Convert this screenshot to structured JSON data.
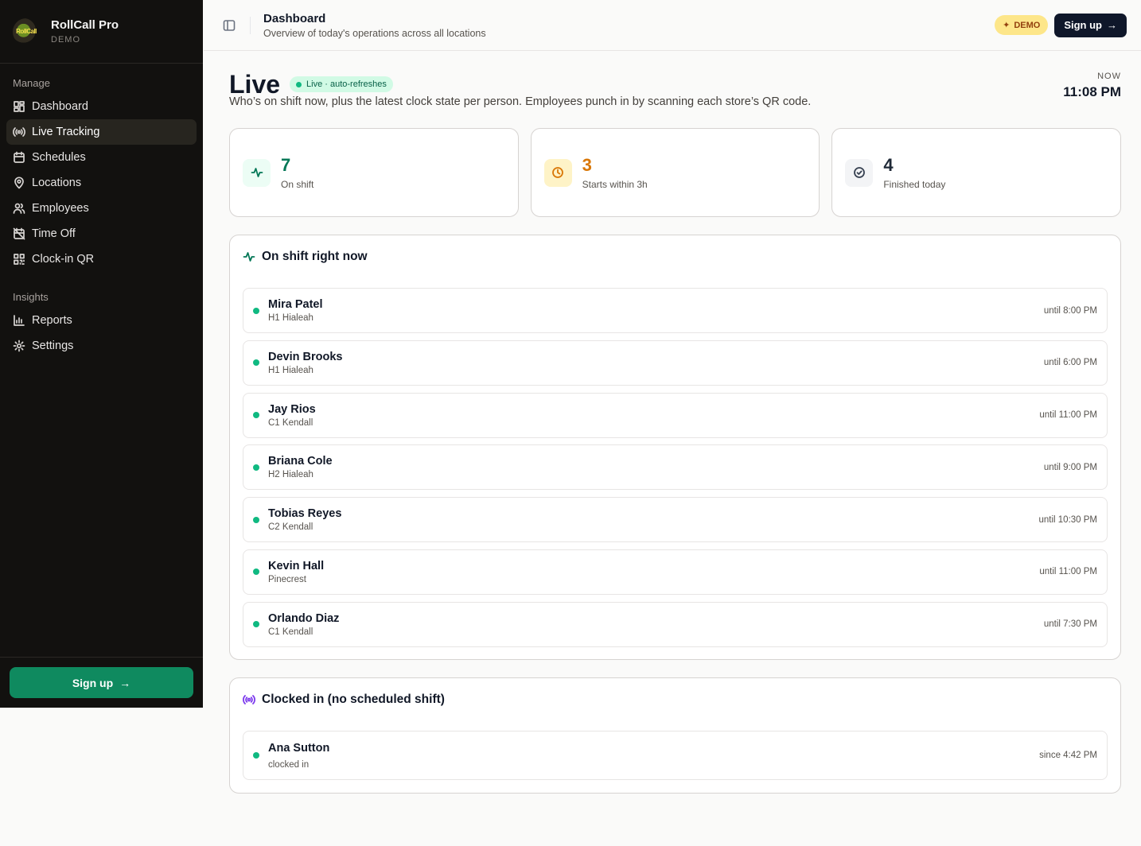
{
  "brand": {
    "name": "RollCall Pro",
    "sub": "DEMO",
    "logo_text": "RollCall"
  },
  "sidebar": {
    "sections": [
      {
        "label": "Manage",
        "items": [
          {
            "label": "Dashboard",
            "icon": "dashboard-icon"
          },
          {
            "label": "Live Tracking",
            "icon": "broadcast-icon",
            "active": true
          },
          {
            "label": "Schedules",
            "icon": "calendar-icon"
          },
          {
            "label": "Locations",
            "icon": "map-pin-icon"
          },
          {
            "label": "Employees",
            "icon": "users-icon"
          },
          {
            "label": "Time Off",
            "icon": "calendar-off-icon"
          },
          {
            "label": "Clock-in QR",
            "icon": "qr-code-icon"
          }
        ]
      },
      {
        "label": "Insights",
        "items": [
          {
            "label": "Reports",
            "icon": "bar-chart-icon"
          },
          {
            "label": "Settings",
            "icon": "gear-icon"
          }
        ]
      }
    ],
    "signup_label": "Sign up"
  },
  "header": {
    "title": "Dashboard",
    "subtitle": "Overview of today's operations across all locations",
    "demo_badge": "DEMO",
    "signup_label": "Sign up"
  },
  "live": {
    "title": "Live",
    "pill": "Live · auto-refreshes",
    "description": "Who’s on shift now, plus the latest clock state per person. Employees punch in by scanning each store’s QR code.",
    "now_label": "NOW",
    "now_time": "11:08 PM"
  },
  "stats": [
    {
      "value": "7",
      "label": "On shift",
      "color": "#047857",
      "bg": "#ecfdf5",
      "icon": "activity-icon"
    },
    {
      "value": "3",
      "label": "Starts within 3h",
      "color": "#d97706",
      "bg": "#fef3c7",
      "icon": "clock-icon"
    },
    {
      "value": "4",
      "label": "Finished today",
      "color": "#1f2937",
      "bg": "#f3f4f6",
      "icon": "check-circle-icon"
    }
  ],
  "on_shift": {
    "title": "On shift right now",
    "rows": [
      {
        "name": "Mira Patel",
        "location": "H1 Hialeah",
        "until": "until 8:00 PM"
      },
      {
        "name": "Devin Brooks",
        "location": "H1 Hialeah",
        "until": "until 6:00 PM"
      },
      {
        "name": "Jay Rios",
        "location": "C1 Kendall",
        "until": "until 11:00 PM"
      },
      {
        "name": "Briana Cole",
        "location": "H2 Hialeah",
        "until": "until 9:00 PM"
      },
      {
        "name": "Tobias Reyes",
        "location": "C2 Kendall",
        "until": "until 10:30 PM"
      },
      {
        "name": "Kevin Hall",
        "location": "Pinecrest",
        "until": "until 11:00 PM"
      },
      {
        "name": "Orlando Diaz",
        "location": "C1 Kendall",
        "until": "until 7:30 PM"
      }
    ]
  },
  "clocked_in": {
    "title": "Clocked in (no scheduled shift)",
    "rows": [
      {
        "name": "Ana Sutton",
        "location": "clocked in",
        "until": "since 4:42 PM"
      }
    ]
  }
}
